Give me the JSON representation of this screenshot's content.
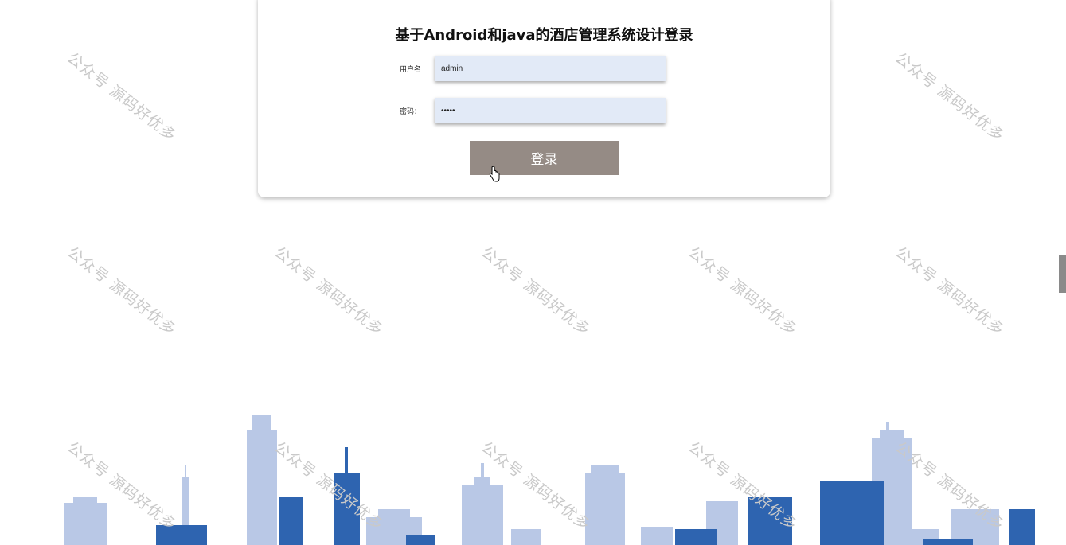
{
  "login": {
    "title": "基于Android和java的酒店管理系统设计登录",
    "username_label": "用户名",
    "username_value": "admin",
    "password_label": "密码：",
    "password_value": "•••••",
    "submit_label": "登录"
  },
  "watermark": {
    "text": "公众号 源码好优多"
  },
  "colors": {
    "button_bg": "#958b85",
    "input_bg": "#e2eaf7",
    "skyline_light": "#b9c8e6",
    "skyline_dark": "#2e64b0",
    "watermark": "#c9c9c9"
  }
}
